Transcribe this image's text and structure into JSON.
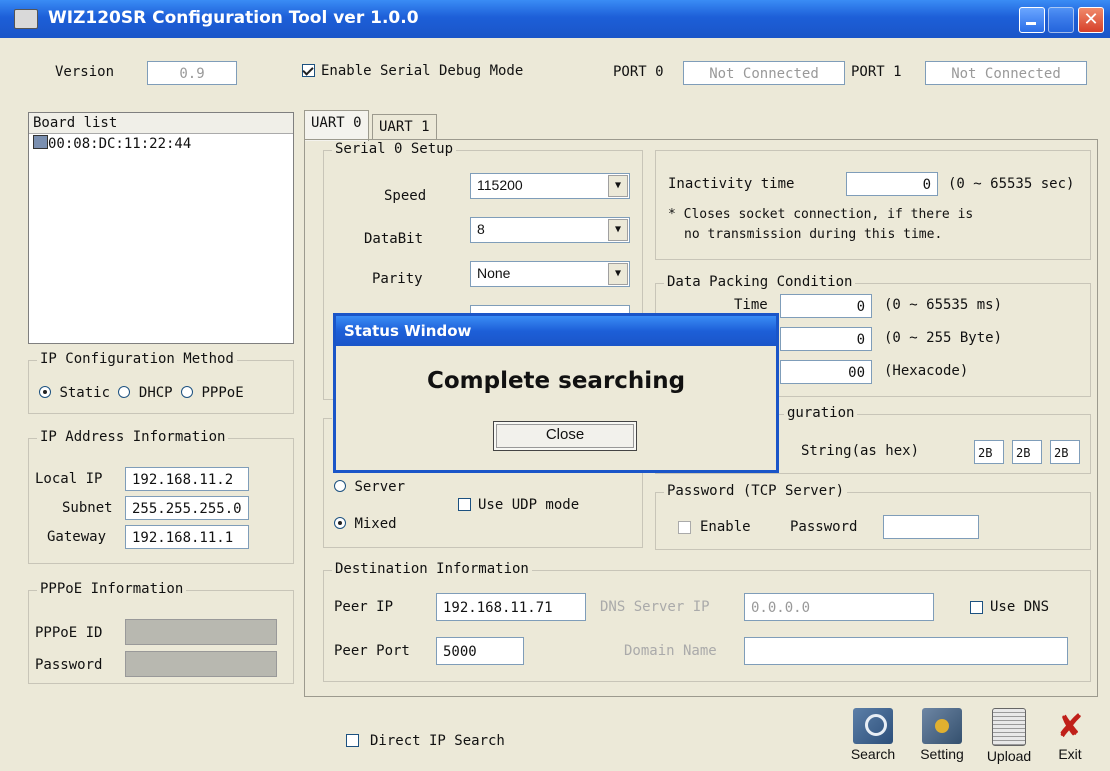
{
  "window": {
    "title": "WIZ120SR Configuration Tool ver 1.0.0"
  },
  "top": {
    "version_label": "Version",
    "version_value": "0.9",
    "debug_label": "Enable Serial Debug Mode",
    "debug_checked": true,
    "port0_label": "PORT 0",
    "port0_value": "Not Connected",
    "port1_label": "PORT 1",
    "port1_value": "Not Connected"
  },
  "board_list": {
    "header": "Board list",
    "items": [
      "00:08:DC:11:22:44"
    ]
  },
  "ip_method": {
    "title": "IP Configuration Method",
    "options": [
      "Static",
      "DHCP",
      "PPPoE"
    ],
    "selected": "Static"
  },
  "ip_info": {
    "title": "IP Address Information",
    "local_ip_label": "Local IP",
    "local_ip": "192.168.11.2",
    "subnet_label": "Subnet",
    "subnet": "255.255.255.0",
    "gateway_label": "Gateway",
    "gateway": "192.168.11.1"
  },
  "pppoe": {
    "title": "PPPoE Information",
    "id_label": "PPPoE ID",
    "password_label": "Password"
  },
  "tabs": [
    "UART 0",
    "UART 1"
  ],
  "serial": {
    "title": "Serial 0 Setup",
    "speed_label": "Speed",
    "speed": "115200",
    "databit_label": "DataBit",
    "databit": "8",
    "parity_label": "Parity",
    "parity": "None"
  },
  "inactivity": {
    "label": "Inactivity time",
    "value": "0",
    "range": "(0 ~ 65535 sec)",
    "note1": "* Closes socket connection, if there is",
    "note2": "no transmission during this time."
  },
  "packing": {
    "title": "Data Packing Condition",
    "time_label": "Time",
    "time_value": "0",
    "time_range": "(0 ~ 65535 ms)",
    "size_value": "0",
    "size_range": "(0 ~ 255 Byte)",
    "char_value": "00",
    "char_range": "(Hexacode)"
  },
  "operation": {
    "title_partial": "O",
    "client_partial": "(",
    "server_label": "Server",
    "mixed_label": "Mixed",
    "selected": "Mixed",
    "udp_label": "Use UDP mode"
  },
  "trigger": {
    "title_partial": "guration",
    "string_label": "String(as hex)",
    "values": [
      "2B",
      "2B",
      "2B"
    ]
  },
  "password_tcp": {
    "title": "Password (TCP Server)",
    "enable_label": "Enable",
    "password_label": "Password"
  },
  "destination": {
    "title": "Destination Information",
    "peer_ip_label": "Peer IP",
    "peer_ip": "192.168.11.71",
    "dns_server_label": "DNS Server IP",
    "dns_server": "0.0.0.0",
    "use_dns_label": "Use DNS",
    "peer_port_label": "Peer Port",
    "peer_port": "5000",
    "domain_label": "Domain Name"
  },
  "bottom": {
    "direct_ip_label": "Direct IP Search",
    "buttons": {
      "search": "Search",
      "setting": "Setting",
      "upload": "Upload",
      "exit": "Exit"
    }
  },
  "dialog": {
    "title": "Status Window",
    "message": "Complete searching",
    "button": "Close"
  }
}
